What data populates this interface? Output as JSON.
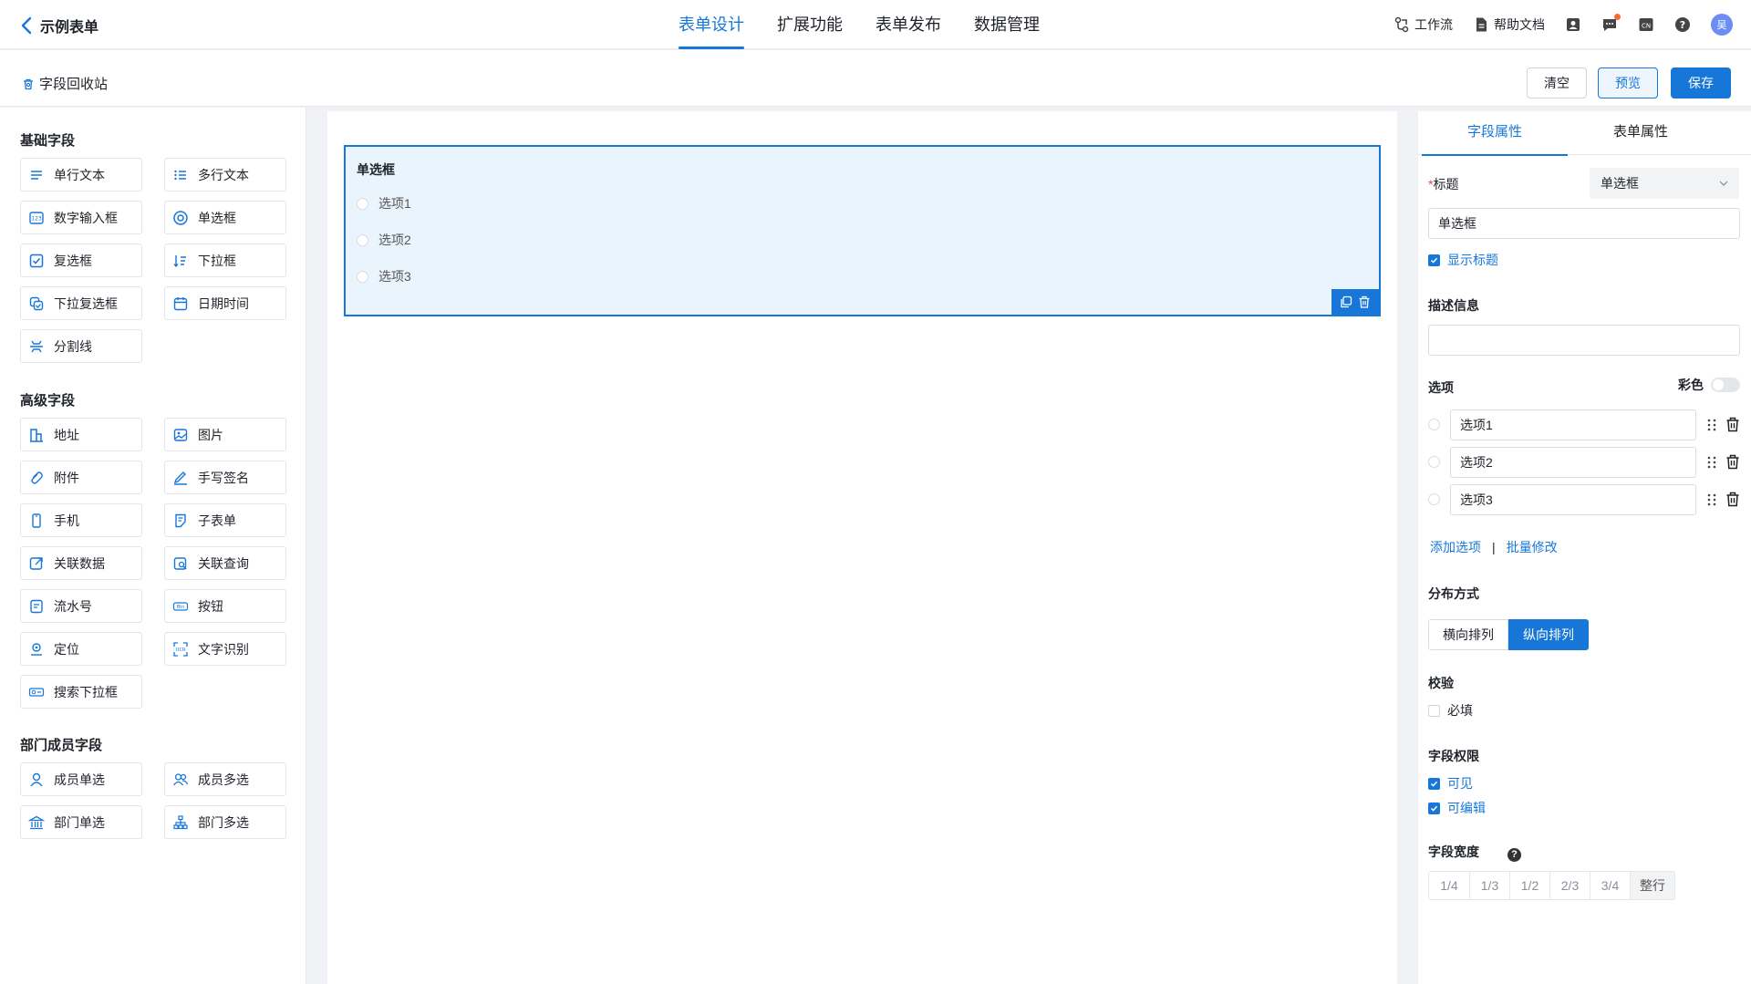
{
  "header": {
    "back_label": "示例表单",
    "tabs": [
      {
        "label": "表单设计",
        "active": true
      },
      {
        "label": "扩展功能",
        "active": false
      },
      {
        "label": "表单发布",
        "active": false
      },
      {
        "label": "数据管理",
        "active": false
      }
    ],
    "workflow_label": "工作流",
    "help_docs_label": "帮助文档",
    "avatar_text": "吴",
    "accent_color": "#1677d9"
  },
  "toolbar": {
    "recycle_label": "字段回收站",
    "clear_label": "清空",
    "preview_label": "预览",
    "save_label": "保存"
  },
  "palette": {
    "basic_title": "基础字段",
    "basic": [
      {
        "label": "单行文本",
        "icon": "single-line-text-icon"
      },
      {
        "label": "多行文本",
        "icon": "multi-line-text-icon"
      },
      {
        "label": "数字输入框",
        "icon": "number-input-icon"
      },
      {
        "label": "单选框",
        "icon": "radio-icon"
      },
      {
        "label": "复选框",
        "icon": "checkbox-icon"
      },
      {
        "label": "下拉框",
        "icon": "dropdown-icon"
      },
      {
        "label": "下拉复选框",
        "icon": "multi-dropdown-icon"
      },
      {
        "label": "日期时间",
        "icon": "calendar-icon"
      },
      {
        "label": "分割线",
        "icon": "divider-icon"
      }
    ],
    "advanced_title": "高级字段",
    "advanced": [
      {
        "label": "地址",
        "icon": "building-icon"
      },
      {
        "label": "图片",
        "icon": "image-icon"
      },
      {
        "label": "附件",
        "icon": "attachment-icon"
      },
      {
        "label": "手写签名",
        "icon": "signature-icon"
      },
      {
        "label": "手机",
        "icon": "phone-icon"
      },
      {
        "label": "子表单",
        "icon": "subform-icon"
      },
      {
        "label": "关联数据",
        "icon": "link-data-icon"
      },
      {
        "label": "关联查询",
        "icon": "link-query-icon"
      },
      {
        "label": "流水号",
        "icon": "serial-number-icon"
      },
      {
        "label": "按钮",
        "icon": "button-icon"
      },
      {
        "label": "定位",
        "icon": "location-icon"
      },
      {
        "label": "文字识别",
        "icon": "ocr-icon"
      },
      {
        "label": "搜索下拉框",
        "icon": "search-dropdown-icon"
      }
    ],
    "member_title": "部门成员字段",
    "member": [
      {
        "label": "成员单选",
        "icon": "user-icon"
      },
      {
        "label": "成员多选",
        "icon": "users-icon"
      },
      {
        "label": "部门单选",
        "icon": "department-icon"
      },
      {
        "label": "部门多选",
        "icon": "org-chart-icon"
      }
    ]
  },
  "canvas": {
    "field_title": "单选框",
    "options": [
      "选项1",
      "选项2",
      "选项3"
    ]
  },
  "properties": {
    "tabs": [
      "字段属性",
      "表单属性"
    ],
    "title_label": "标题",
    "type_select": "单选框",
    "title_value": "单选框",
    "show_title_label": "显示标题",
    "desc_label": "描述信息",
    "desc_value": "",
    "options_label": "选项",
    "color_label": "彩色",
    "options": [
      "选项1",
      "选项2",
      "选项3"
    ],
    "add_option_label": "添加选项",
    "separator": "|",
    "batch_edit_label": "批量修改",
    "layout_label": "分布方式",
    "layout_options": [
      "横向排列",
      "纵向排列"
    ],
    "validation_label": "校验",
    "required_label": "必填",
    "permission_label": "字段权限",
    "visible_label": "可见",
    "editable_label": "可编辑",
    "width_label": "字段宽度",
    "help_glyph": "?",
    "width_options": [
      "1/4",
      "1/3",
      "1/2",
      "2/3",
      "3/4",
      "整行"
    ]
  }
}
